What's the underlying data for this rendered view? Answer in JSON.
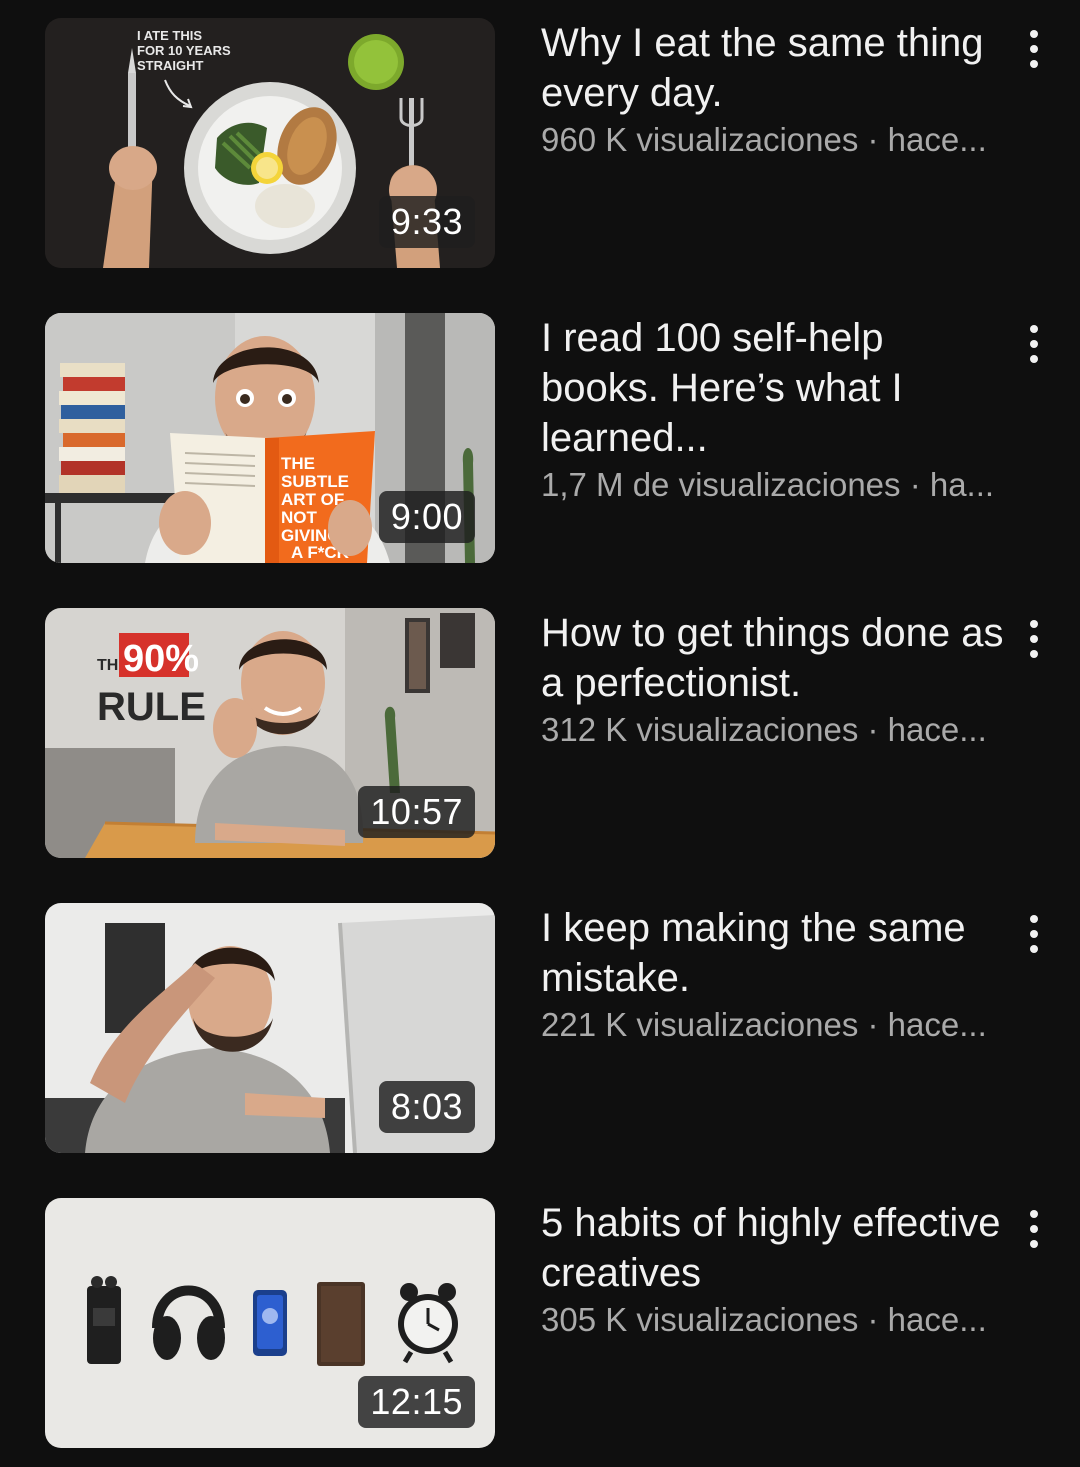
{
  "videos": [
    {
      "title": "Why I eat the same thing every day.",
      "meta": "960 K visualizaciones · hace...",
      "duration": "9:33",
      "thumb_text": [
        "I ATE THIS",
        "FOR 10 YEARS",
        "STRAIGHT"
      ],
      "menu_icon": "more-vert-icon"
    },
    {
      "title": "I read 100 self-help books. Here’s what I learned...",
      "meta": "1,7 M de visualizaciones · ha...",
      "duration": "9:00",
      "thumb_text": [
        "THE",
        "SUBTLE",
        "ART OF",
        "NOT",
        "GIVING",
        "A F*CK"
      ],
      "menu_icon": "more-vert-icon"
    },
    {
      "title": "How to get things done as a perfectionist.",
      "meta": "312 K visualizaciones · hace...",
      "duration": "10:57",
      "thumb_text": [
        "THE",
        "90%",
        "RULE"
      ],
      "menu_icon": "more-vert-icon"
    },
    {
      "title": "I keep making the same mistake.",
      "meta": "221 K visualizaciones · hace...",
      "duration": "8:03",
      "thumb_text": [],
      "menu_icon": "more-vert-icon"
    },
    {
      "title": "5 habits of highly effective creatives",
      "meta": "305 K visualizaciones · hace...",
      "duration": "12:15",
      "thumb_text": [],
      "menu_icon": "more-vert-icon"
    }
  ],
  "colors": {
    "background": "#0f0f0f",
    "title": "#f1f1f1",
    "meta": "#aaaaaa",
    "accent_red": "#d6322b",
    "book_orange": "#f26b1d"
  }
}
